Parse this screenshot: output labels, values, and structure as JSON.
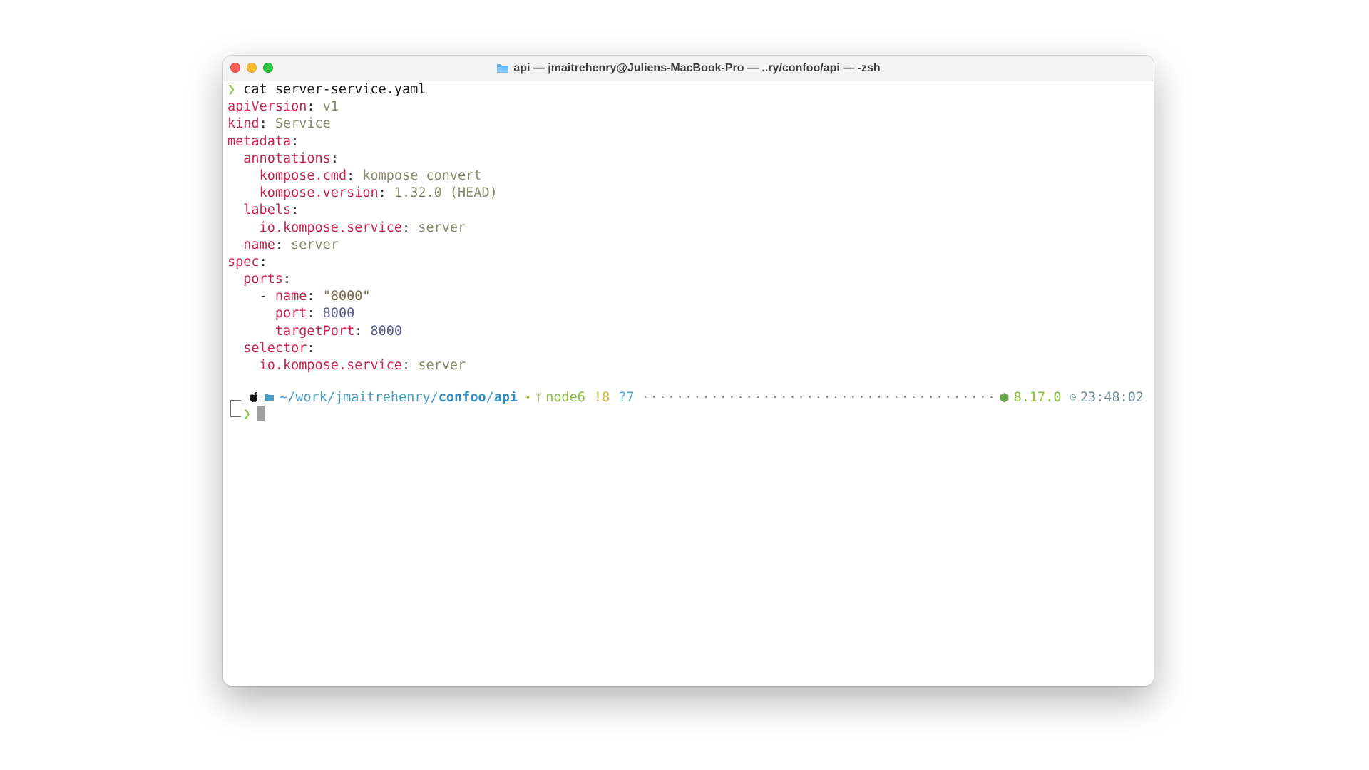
{
  "window": {
    "title": "api — jmaitrehenry@Juliens-MacBook-Pro — ..ry/confoo/api — -zsh"
  },
  "terminal": {
    "prompt_symbol": "❯",
    "command": "cat server-service.yaml",
    "yaml": {
      "apiVersion_key": "apiVersion",
      "apiVersion_val": "v1",
      "kind_key": "kind",
      "kind_val": "Service",
      "metadata_key": "metadata",
      "annotations_key": "annotations",
      "kompose_cmd_key": "kompose.cmd",
      "kompose_cmd_val": "kompose convert",
      "kompose_version_key": "kompose.version",
      "kompose_version_val": "1.32.0 (HEAD)",
      "labels_key": "labels",
      "io_service_key": "io.kompose.service",
      "io_service_val": "server",
      "name_key": "name",
      "name_val": "server",
      "spec_key": "spec",
      "ports_key": "ports",
      "port_name_key": "name",
      "port_name_val": "\"8000\"",
      "port_key": "port",
      "port_val": "8000",
      "targetPort_key": "targetPort",
      "targetPort_val": "8000",
      "selector_key": "selector",
      "selector_io_key": "io.kompose.service",
      "selector_io_val": "server"
    }
  },
  "statusline": {
    "path_base": "~/work/jmaitrehenry/",
    "path_confoo": "confoo",
    "path_sep": "/",
    "path_api": "api",
    "branch": "node6",
    "modified": "!8",
    "untracked": "?7",
    "dots": "··············································································",
    "node_version": "8.17.0",
    "time": "23:48:02"
  },
  "prompt2": {
    "symbol": "❯"
  }
}
